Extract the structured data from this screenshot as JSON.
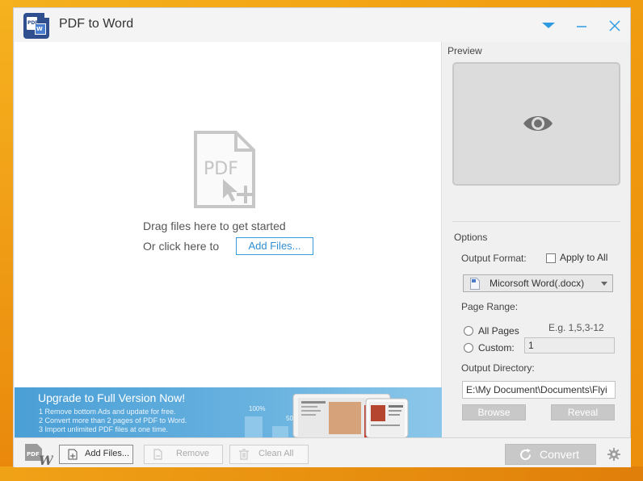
{
  "window": {
    "title": "PDF to Word",
    "logo_text_top": "PDF",
    "logo_text_bottom": "W"
  },
  "droparea": {
    "icon_text": "PDF",
    "drag_text": "Drag files here to get started",
    "or_text": "Or click here to",
    "add_files_link": "Add Files..."
  },
  "banner": {
    "title": "Upgrade to Full Version Now!",
    "lines": [
      "1 Remove bottom Ads and update for free.",
      "2 Convert more than 2 pages of PDF to Word.",
      "3 Import unlimited PDF files at one time."
    ],
    "pct_label": "100%",
    "pct_label_2": "50"
  },
  "preview": {
    "label": "Preview"
  },
  "options": {
    "label": "Options",
    "output_format_label": "Output Format:",
    "apply_to_all_label": "Apply to All",
    "apply_to_all_checked": false,
    "format_value": "Micorsoft Word(.docx)",
    "page_range_label": "Page Range:",
    "example_text": "E.g. 1,5,3-12",
    "all_pages_label": "All Pages",
    "custom_label": "Custom:",
    "custom_value": "1",
    "output_directory_label": "Output Directory:",
    "output_directory_value": "E:\\My Document\\Documents\\Flyi",
    "browse_label": "Browse",
    "reveal_label": "Reveal"
  },
  "toolbar": {
    "add_files_label": "Add Files...",
    "remove_label": "Remove",
    "clean_all_label": "Clean All",
    "convert_label": "Convert"
  },
  "colors": {
    "accent_blue": "#2e8fd3",
    "banner_blue": "#4a9fd6",
    "disabled_gray": "#c8c8c8",
    "desktop_orange": "#f2a012"
  }
}
